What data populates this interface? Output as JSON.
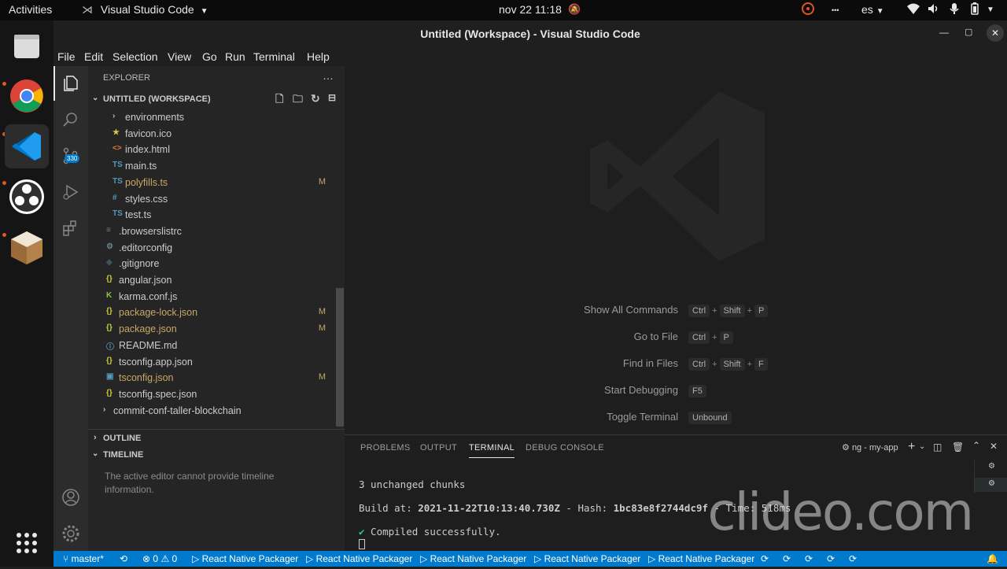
{
  "system": {
    "activities": "Activities",
    "app_menu": "Visual Studio Code",
    "clock": "nov 22  11:18",
    "ellipsis": "•••",
    "keyboard_layout": "es"
  },
  "window": {
    "title": "Untitled (Workspace) - Visual Studio Code"
  },
  "menu": [
    "File",
    "Edit",
    "Selection",
    "View",
    "Go",
    "Run",
    "Terminal",
    "Help"
  ],
  "activity": {
    "scm_badge": "330"
  },
  "explorer": {
    "title": "EXPLORER",
    "more": "…",
    "workspace": "UNTITLED (WORKSPACE)",
    "items": [
      {
        "name": "environments",
        "icon": "›",
        "color": "#c5c5c5",
        "modified": ""
      },
      {
        "name": "favicon.ico",
        "icon": "★",
        "color": "#cbcb41",
        "modified": ""
      },
      {
        "name": "index.html",
        "icon": "<>",
        "color": "#e37933",
        "modified": ""
      },
      {
        "name": "main.ts",
        "icon": "TS",
        "color": "#519aba",
        "modified": ""
      },
      {
        "name": "polyfills.ts",
        "icon": "TS",
        "color": "#519aba",
        "modified": "M"
      },
      {
        "name": "styles.css",
        "icon": "#",
        "color": "#519aba",
        "modified": ""
      },
      {
        "name": "test.ts",
        "icon": "TS",
        "color": "#519aba",
        "modified": ""
      },
      {
        "name": ".browserslistrc",
        "icon": "≡",
        "color": "#6d8086",
        "modified": ""
      },
      {
        "name": ".editorconfig",
        "icon": "⚙",
        "color": "#6d8086",
        "modified": ""
      },
      {
        "name": ".gitignore",
        "icon": "◆",
        "color": "#41535b",
        "modified": ""
      },
      {
        "name": "angular.json",
        "icon": "{}",
        "color": "#cbcb41",
        "modified": ""
      },
      {
        "name": "karma.conf.js",
        "icon": "K",
        "color": "#8dc149",
        "modified": ""
      },
      {
        "name": "package-lock.json",
        "icon": "{}",
        "color": "#cbcb41",
        "modified": "M"
      },
      {
        "name": "package.json",
        "icon": "{}",
        "color": "#cbcb41",
        "modified": "M"
      },
      {
        "name": "README.md",
        "icon": "ⓘ",
        "color": "#519aba",
        "modified": ""
      },
      {
        "name": "tsconfig.app.json",
        "icon": "{}",
        "color": "#cbcb41",
        "modified": ""
      },
      {
        "name": "tsconfig.json",
        "icon": "▣",
        "color": "#519aba",
        "modified": "M"
      },
      {
        "name": "tsconfig.spec.json",
        "icon": "{}",
        "color": "#cbcb41",
        "modified": ""
      },
      {
        "name": "commit-conf-taller-blockchain",
        "icon": "›",
        "color": "#c5c5c5",
        "modified": ""
      }
    ],
    "outline": "OUTLINE",
    "timeline": "TIMELINE",
    "timeline_msg": "The active editor cannot provide timeline information."
  },
  "welcome": [
    {
      "label": "Show All Commands",
      "keys": [
        "Ctrl",
        "Shift",
        "P"
      ]
    },
    {
      "label": "Go to File",
      "keys": [
        "Ctrl",
        "P"
      ]
    },
    {
      "label": "Find in Files",
      "keys": [
        "Ctrl",
        "Shift",
        "F"
      ]
    },
    {
      "label": "Start Debugging",
      "keys": [
        "F5"
      ]
    },
    {
      "label": "Toggle Terminal",
      "keys": [
        "Unbound"
      ]
    }
  ],
  "panel": {
    "tabs": [
      "PROBLEMS",
      "OUTPUT",
      "TERMINAL",
      "DEBUG CONSOLE"
    ],
    "terminal_name": "ng - my-app",
    "lines": {
      "l1": "3 unchanged chunks",
      "l2a": "Build at: ",
      "l2b": "2021-11-22T10:13:40.730Z",
      "l2c": " - Hash: ",
      "l2d": "1bc83e8f2744dc9f",
      "l2e": " - Time: 518ms",
      "l3check": "✔",
      "l3": " Compiled successfully."
    }
  },
  "status": {
    "branch": "master*",
    "errors": "0",
    "warnings": "0",
    "packagers": [
      "React Native Packager",
      "React Native Packager",
      "React Native Packager",
      "React Native Packager",
      "React Native Packager"
    ]
  },
  "watermark": "clideo.com",
  "colors": {
    "accent": "#007acc",
    "modified": "#c8a866"
  }
}
